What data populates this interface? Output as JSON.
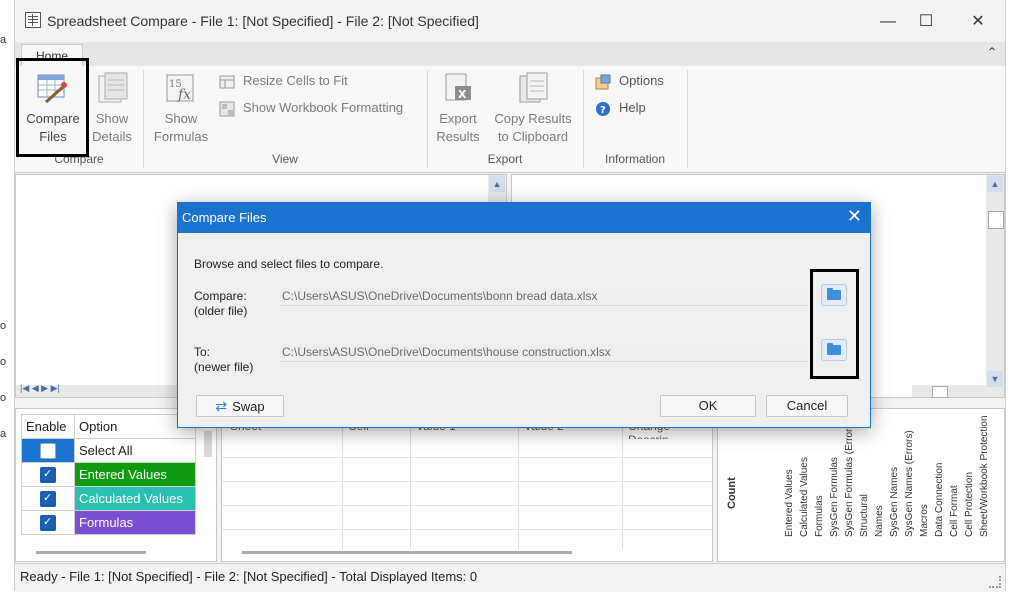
{
  "window": {
    "title": "Spreadsheet Compare - File 1: [Not Specified] - File 2: [Not Specified]",
    "minimize_glyph": "—",
    "maximize_glyph": "☐",
    "close_glyph": "✕"
  },
  "edge_marks": [
    "a",
    "o",
    "o",
    "o",
    "a"
  ],
  "ribbon": {
    "tab": "Home",
    "collapse_glyph": "⌃",
    "groups": {
      "compare": "Compare",
      "view": "View",
      "export": "Export",
      "information": "Information"
    },
    "compare_files": {
      "line1": "Compare",
      "line2": "Files"
    },
    "show_details": {
      "line1": "Show",
      "line2": "Details"
    },
    "show_formulas": {
      "line1": "Show",
      "line2": "Formulas"
    },
    "resize_cells": "Resize Cells to Fit",
    "show_workbook_formatting": "Show Workbook Formatting",
    "export_results": {
      "line1": "Export",
      "line2": "Results"
    },
    "copy_results": {
      "line1": "Copy Results",
      "line2": "to Clipboard"
    },
    "options": "Options",
    "help": "Help"
  },
  "options_grid": {
    "headers": {
      "enable": "Enable",
      "option": "Option"
    },
    "rows": [
      {
        "label": "Select All",
        "checked": false,
        "color": "#ffffff"
      },
      {
        "label": "Entered Values",
        "checked": true,
        "color": "#109a10"
      },
      {
        "label": "Calculated Values",
        "checked": true,
        "color": "#28c0b0"
      },
      {
        "label": "Formulas",
        "checked": true,
        "color": "#7a4fd0"
      }
    ]
  },
  "results_grid": {
    "headers": [
      "Sheet",
      "Cell",
      "Value 1",
      "Value 2",
      "Change Descrip"
    ]
  },
  "chart_labels": {
    "count": "Count",
    "columns": [
      "Entered Values",
      "Calculated Values",
      "Formulas",
      "SysGen Formulas",
      "SysGen Formulas (Errors)",
      "Structural",
      "Names",
      "SysGen Names",
      "SysGen Names (Errors)",
      "Macros",
      "Data Connection",
      "Cell Format",
      "Cell Protection",
      "Sheet/Workbook Protection"
    ]
  },
  "status_bar": "Ready - File 1: [Not Specified] - File 2: [Not Specified] - Total Displayed Items: 0",
  "dialog": {
    "title": "Compare Files",
    "close_glyph": "✕",
    "instruction": "Browse and select files to compare.",
    "compare_label": "Compare:",
    "compare_sub": "(older file)",
    "compare_path": "C:\\Users\\ASUS\\OneDrive\\Documents\\bonn bread data.xlsx",
    "to_label": "To:",
    "to_sub": "(newer file)",
    "to_path": "C:\\Users\\ASUS\\OneDrive\\Documents\\house construction.xlsx",
    "swap": "Swap",
    "ok": "OK",
    "cancel": "Cancel"
  }
}
